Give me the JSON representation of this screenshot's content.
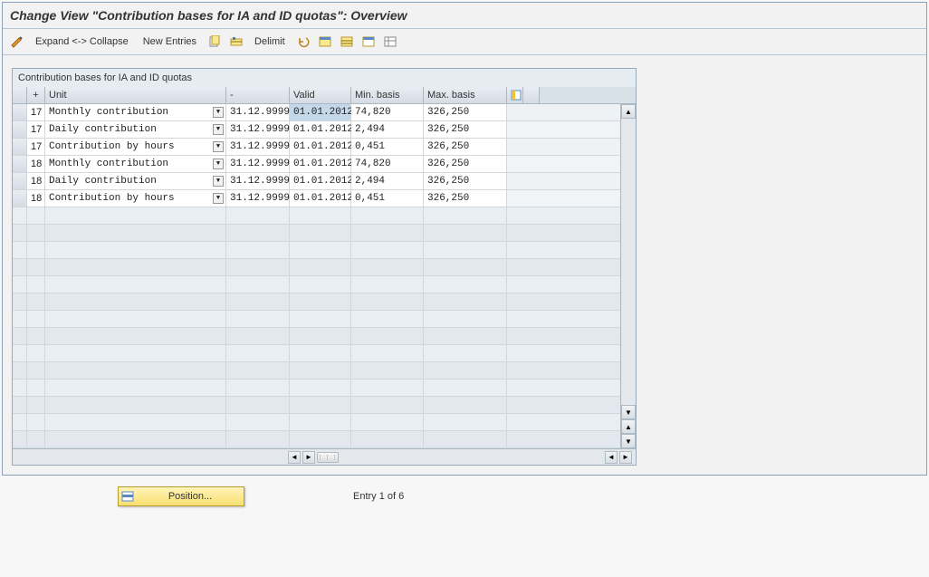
{
  "title": "Change View \"Contribution bases for IA and ID quotas\": Overview",
  "toolbar": {
    "expand_collapse": "Expand <-> Collapse",
    "new_entries": "New Entries",
    "delimit": "Delimit"
  },
  "panel": {
    "caption": "Contribution bases for IA and ID quotas",
    "columns": {
      "plus": "+",
      "unit": "Unit",
      "dash": "-",
      "valid": "Valid",
      "min": "Min. basis",
      "max": "Max. basis"
    },
    "rows": [
      {
        "plus": "17",
        "unit": "Monthly contribution",
        "dash": "31.12.9999",
        "valid": "01.01.2012",
        "min": "74,820",
        "max": "326,250",
        "hl": true
      },
      {
        "plus": "17",
        "unit": "Daily contribution",
        "dash": "31.12.9999",
        "valid": "01.01.2012",
        "min": "2,494",
        "max": "326,250",
        "hl": false
      },
      {
        "plus": "17",
        "unit": "Contribution by hours",
        "dash": "31.12.9999",
        "valid": "01.01.2012",
        "min": "0,451",
        "max": "326,250",
        "hl": false
      },
      {
        "plus": "18",
        "unit": "Monthly contribution",
        "dash": "31.12.9999",
        "valid": "01.01.2012",
        "min": "74,820",
        "max": "326,250",
        "hl": false
      },
      {
        "plus": "18",
        "unit": "Daily contribution",
        "dash": "31.12.9999",
        "valid": "01.01.2012",
        "min": "2,494",
        "max": "326,250",
        "hl": false
      },
      {
        "plus": "18",
        "unit": "Contribution by hours",
        "dash": "31.12.9999",
        "valid": "01.01.2012",
        "min": "0,451",
        "max": "326,250",
        "hl": false
      }
    ],
    "empty_row_count": 14
  },
  "footer": {
    "position_label": "Position...",
    "entry_text": "Entry 1 of 6"
  }
}
